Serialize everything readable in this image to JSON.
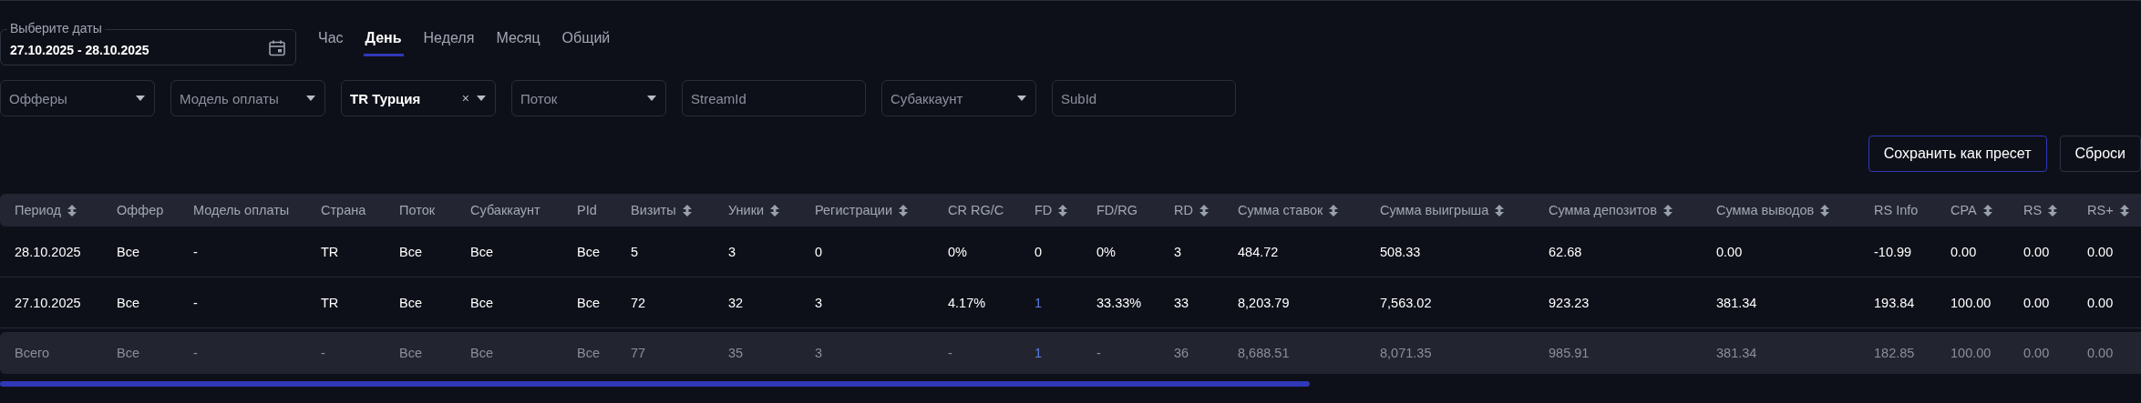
{
  "date_picker": {
    "label": "Выберите даты",
    "value": "27.10.2025 - 28.10.2025"
  },
  "period_tabs": [
    {
      "label": "Час",
      "selected": false
    },
    {
      "label": "День",
      "selected": true
    },
    {
      "label": "Неделя",
      "selected": false
    },
    {
      "label": "Месяц",
      "selected": false
    },
    {
      "label": "Общий",
      "selected": false
    }
  ],
  "filters": [
    {
      "kind": "select",
      "placeholder": "Офферы"
    },
    {
      "kind": "select",
      "placeholder": "Модель оплаты"
    },
    {
      "kind": "select",
      "value": "TR Турция",
      "clear": "×"
    },
    {
      "kind": "select",
      "placeholder": "Поток"
    },
    {
      "kind": "input",
      "placeholder": "StreamId"
    },
    {
      "kind": "select",
      "placeholder": "Субаккаунт"
    },
    {
      "kind": "input",
      "placeholder": "SubId"
    }
  ],
  "buttons": [
    {
      "label": "Сохранить как пресет",
      "primary": true
    },
    {
      "label": "Сброси",
      "primary": false
    }
  ],
  "table": {
    "columns": [
      {
        "label": "Период",
        "sortable": true
      },
      {
        "label": "Оффер",
        "sortable": false
      },
      {
        "label": "Модель оплаты",
        "sortable": false
      },
      {
        "label": "Страна",
        "sortable": false
      },
      {
        "label": "Поток",
        "sortable": false
      },
      {
        "label": "Субаккаунт",
        "sortable": false
      },
      {
        "label": "PId",
        "sortable": false
      },
      {
        "label": "Визиты",
        "sortable": true
      },
      {
        "label": "Уники",
        "sortable": true
      },
      {
        "label": "Регистрации",
        "sortable": true
      },
      {
        "label": "CR RG/C",
        "sortable": false
      },
      {
        "label": "FD",
        "sortable": true
      },
      {
        "label": "FD/RG",
        "sortable": false
      },
      {
        "label": "RD",
        "sortable": true
      },
      {
        "label": "Сумма ставок",
        "sortable": true
      },
      {
        "label": "Сумма выигрыша",
        "sortable": true
      },
      {
        "label": "Сумма депозитов",
        "sortable": true
      },
      {
        "label": "Сумма выводов",
        "sortable": true
      },
      {
        "label": "RS Info",
        "sortable": false
      },
      {
        "label": "CPA",
        "sortable": true
      },
      {
        "label": "RS",
        "sortable": true
      },
      {
        "label": "RS+",
        "sortable": true
      }
    ],
    "rows": [
      {
        "kind": "data",
        "fd_link": false,
        "cells": [
          "28.10.2025",
          "Все",
          "-",
          "TR",
          "Все",
          "Все",
          "Все",
          "5",
          "3",
          "0",
          "0%",
          "0",
          "0%",
          "3",
          "484.72",
          "508.33",
          "62.68",
          "0.00",
          "-10.99",
          "0.00",
          "0.00",
          "0.00"
        ]
      },
      {
        "kind": "data",
        "fd_link": true,
        "cells": [
          "27.10.2025",
          "Все",
          "-",
          "TR",
          "Все",
          "Все",
          "Все",
          "72",
          "32",
          "3",
          "4.17%",
          "1",
          "33.33%",
          "33",
          "8,203.79",
          "7,563.02",
          "923.23",
          "381.34",
          "193.84",
          "100.00",
          "0.00",
          "0.00"
        ]
      },
      {
        "kind": "total",
        "fd_link": true,
        "cells": [
          "Всего",
          "Все",
          "-",
          "-",
          "Все",
          "Все",
          "Все",
          "77",
          "35",
          "3",
          "-",
          "1",
          "-",
          "36",
          "8,688.51",
          "8,071.35",
          "985.91",
          "381.34",
          "182.85",
          "100.00",
          "0.00",
          "0.00"
        ]
      }
    ]
  }
}
